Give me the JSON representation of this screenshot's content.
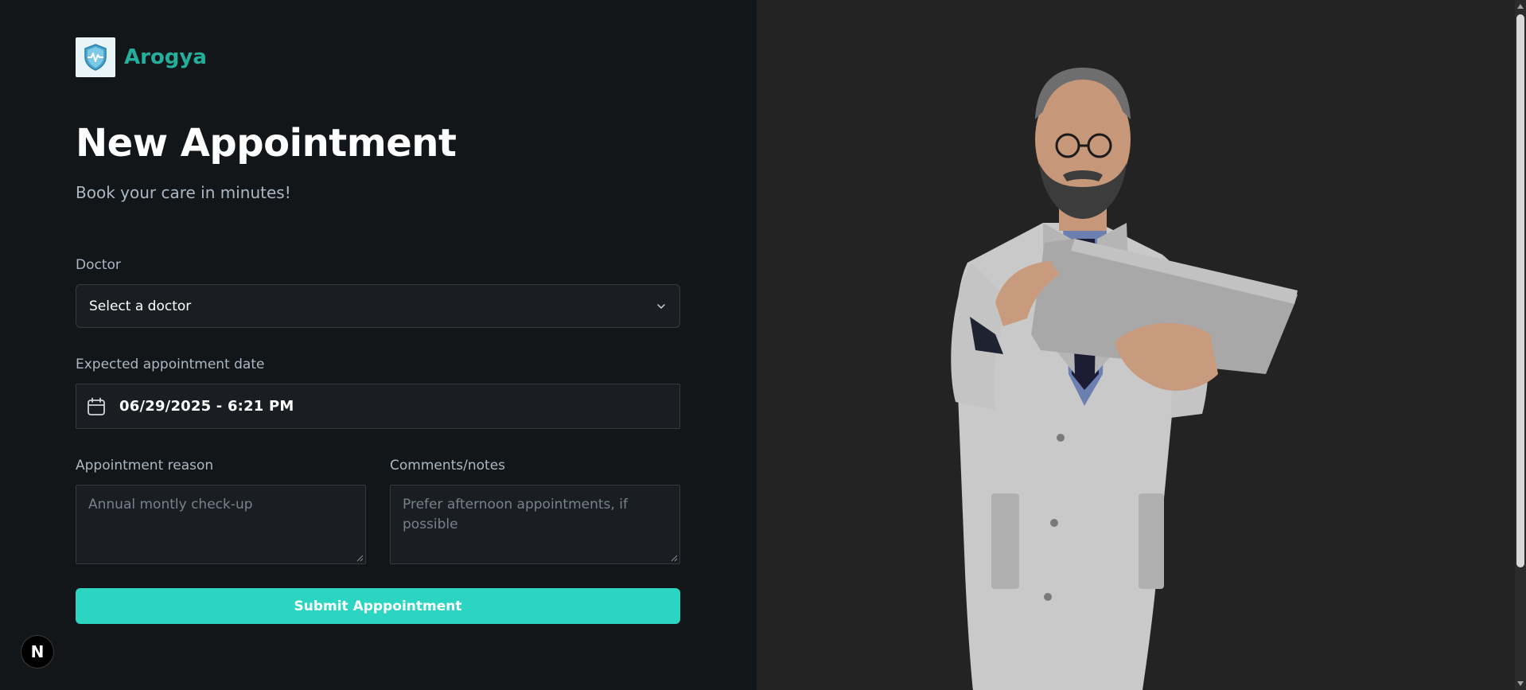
{
  "brand": {
    "name": "Arogya"
  },
  "header": {
    "title": "New Appointment",
    "subtitle": "Book your care in minutes!"
  },
  "form": {
    "doctor": {
      "label": "Doctor",
      "value": "Select a doctor"
    },
    "date": {
      "label": "Expected appointment date",
      "value": "06/29/2025 - 6:21 PM"
    },
    "reason": {
      "label": "Appointment reason",
      "placeholder": "Annual montly check-up"
    },
    "notes": {
      "label": "Comments/notes",
      "placeholder": "Prefer afternoon appointments, if possible"
    },
    "submit_label": "Submit Apppointment"
  },
  "dev_badge": {
    "label": "N"
  },
  "colors": {
    "accent": "#24ae9c",
    "button": "#2cd5c2",
    "background": "#131619",
    "field": "#1a1d21"
  },
  "icons": [
    "medical-shield-icon",
    "chevron-down-icon",
    "calendar-icon"
  ],
  "illustration": {
    "subject": "doctor-avatar-with-tablet"
  }
}
